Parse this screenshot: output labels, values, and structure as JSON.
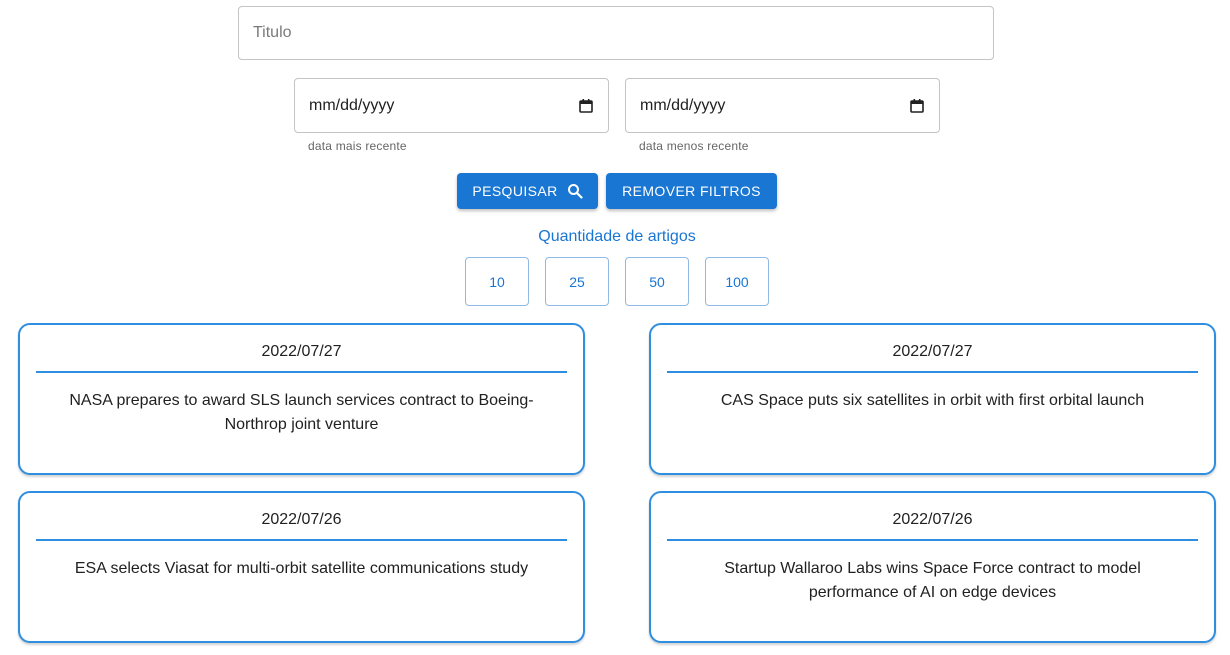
{
  "search": {
    "title_placeholder": "Titulo",
    "date_recent": {
      "value": "mm/dd/yyyy",
      "helper": "data mais recente"
    },
    "date_oldest": {
      "value": "mm/dd/yyyy",
      "helper": "data menos recente"
    }
  },
  "actions": {
    "search_label": "PESQUISAR",
    "clear_label": "REMOVER FILTROS"
  },
  "quantity": {
    "label": "Quantidade de artigos",
    "options": [
      "10",
      "25",
      "50",
      "100"
    ]
  },
  "articles": [
    {
      "date": "2022/07/27",
      "title": "NASA prepares to award SLS launch services contract to Boeing-Northrop joint venture"
    },
    {
      "date": "2022/07/27",
      "title": "CAS Space puts six satellites in orbit with first orbital launch"
    },
    {
      "date": "2022/07/26",
      "title": "ESA selects Viasat for multi-orbit satellite communications study"
    },
    {
      "date": "2022/07/26",
      "title": "Startup Wallaroo Labs wins Space Force contract to model performance of AI on edge devices"
    }
  ],
  "colors": {
    "primary": "#1976d2",
    "card_border": "#2f8ee0"
  },
  "icons": {
    "search": "search-icon",
    "calendar": "calendar-icon"
  }
}
